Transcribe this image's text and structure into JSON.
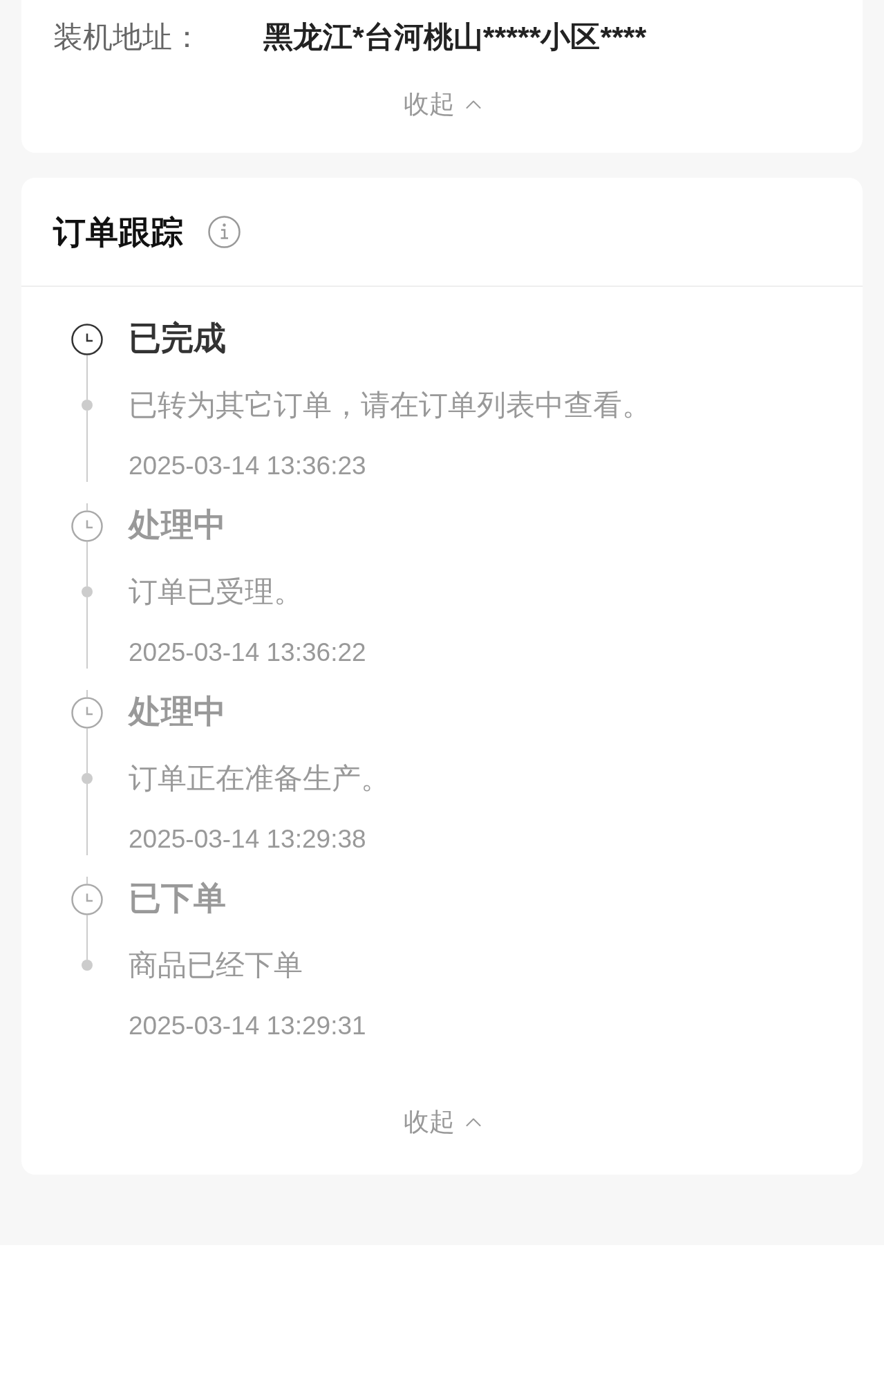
{
  "address_card": {
    "label": "装机地址：",
    "value": "黑龙江*台河桃山*****小区****",
    "collapse_label": "收起"
  },
  "tracking_card": {
    "title": "订单跟踪",
    "events": [
      {
        "status": "已完成",
        "current": true,
        "description": "已转为其它订单，请在订单列表中查看。",
        "time": "2025-03-14 13:36:23"
      },
      {
        "status": "处理中",
        "current": false,
        "description": "订单已受理。",
        "time": "2025-03-14 13:36:22"
      },
      {
        "status": "处理中",
        "current": false,
        "description": "订单正在准备生产。",
        "time": "2025-03-14 13:29:38"
      },
      {
        "status": "已下单",
        "current": false,
        "description": "商品已经下单",
        "time": "2025-03-14 13:29:31"
      }
    ],
    "collapse_label": "收起"
  }
}
